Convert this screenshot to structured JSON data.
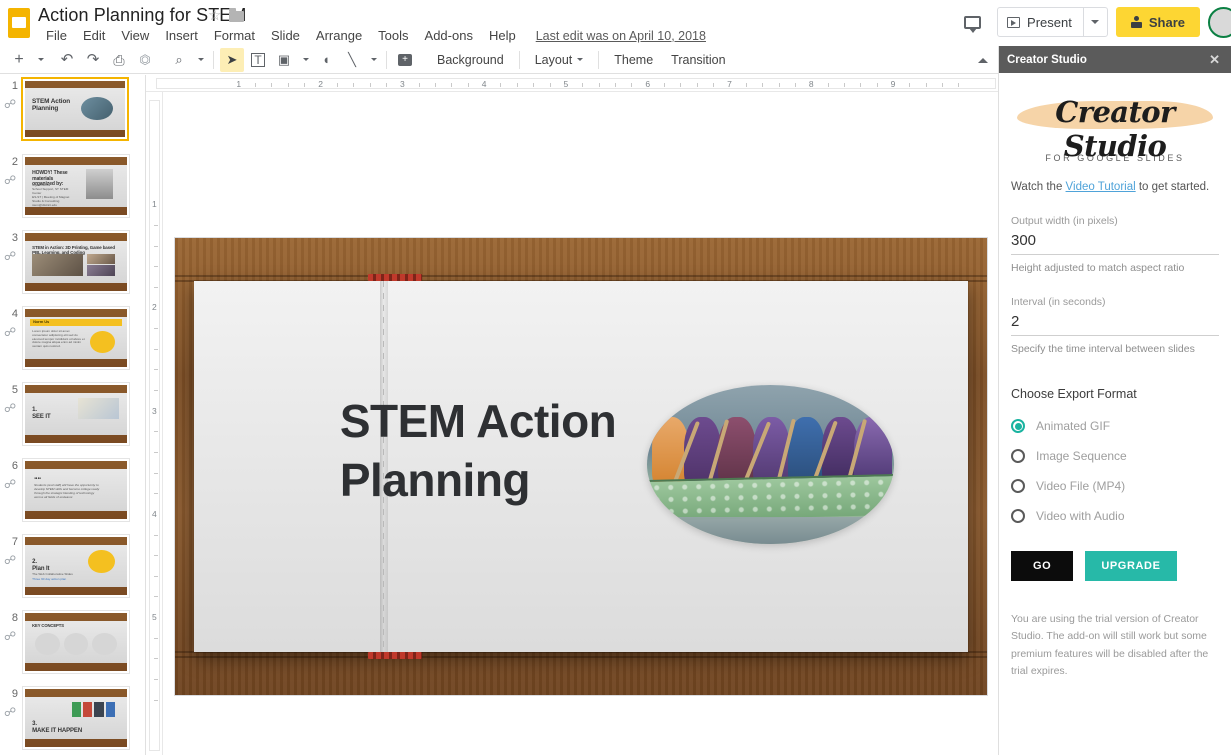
{
  "app": {
    "document_title": "Action Planning for STEM",
    "logo_icon": "google-slides-logo",
    "star_icon": "star-outline-icon",
    "folder_icon": "folder-icon",
    "last_edit": "Last edit was on April 10, 2018"
  },
  "menubar": {
    "items": [
      {
        "label": "File"
      },
      {
        "label": "Edit"
      },
      {
        "label": "View"
      },
      {
        "label": "Insert"
      },
      {
        "label": "Format"
      },
      {
        "label": "Slide"
      },
      {
        "label": "Arrange"
      },
      {
        "label": "Tools"
      },
      {
        "label": "Add-ons"
      },
      {
        "label": "Help"
      }
    ]
  },
  "topright": {
    "comment_icon": "comment-icon",
    "present_label": "Present",
    "present_icon": "present-play-icon",
    "present_caret_icon": "chevron-down-icon",
    "share_label": "Share",
    "share_icon": "person-lock-icon",
    "avatar": "user-avatar"
  },
  "toolbar": {
    "icons": [
      {
        "name": "new-slide-icon",
        "glyph": "+"
      },
      {
        "name": "undo-icon",
        "glyph": "↶"
      },
      {
        "name": "redo-icon",
        "glyph": "↷"
      },
      {
        "name": "print-icon",
        "glyph": "⎙"
      },
      {
        "name": "paint-format-icon",
        "glyph": "⚒"
      },
      {
        "name": "zoom-icon",
        "glyph": "⌕"
      },
      {
        "name": "select-tool-icon",
        "glyph": "➤"
      },
      {
        "name": "text-box-icon",
        "glyph": "T"
      },
      {
        "name": "insert-image-icon",
        "glyph": "▣"
      },
      {
        "name": "shape-icon",
        "glyph": "○"
      },
      {
        "name": "line-icon",
        "glyph": "╲"
      },
      {
        "name": "add-comment-icon",
        "glyph": "+"
      }
    ],
    "buttons": [
      {
        "label": "Background",
        "caret": false
      },
      {
        "label": "Layout",
        "caret": true
      },
      {
        "label": "Theme",
        "caret": false
      },
      {
        "label": "Transition",
        "caret": false
      }
    ],
    "collapse_icon": "chevron-up-icon"
  },
  "rulers": {
    "horizontal_ticks": [
      "1",
      "2",
      "3",
      "4",
      "5",
      "6",
      "7",
      "8",
      "9"
    ],
    "vertical_ticks": [
      "1",
      "2",
      "3",
      "4",
      "5"
    ]
  },
  "filmstrip": {
    "slides": [
      {
        "number": "1",
        "selected": true,
        "title": "STEM Action Planning",
        "kind": "title-photo"
      },
      {
        "number": "2",
        "selected": false,
        "title": "HOWDY! These materials organized by:",
        "kind": "bio"
      },
      {
        "number": "3",
        "selected": false,
        "title": "STEM in Action: 3D Printing, Game based PBL Learning, and Coding",
        "kind": "photo-grid"
      },
      {
        "number": "4",
        "selected": false,
        "title": "Norm Us",
        "kind": "yellow-banner"
      },
      {
        "number": "5",
        "selected": false,
        "title": "1. SEE IT",
        "kind": "numbered"
      },
      {
        "number": "6",
        "selected": false,
        "title": "Students (and staff) will have the opportunity to develop STEM skills and become college ready through the strategic blending of technology across all fields of endeavor.",
        "kind": "quote"
      },
      {
        "number": "7",
        "selected": false,
        "title": "2. Plan It",
        "kind": "numbered-icon"
      },
      {
        "number": "8",
        "selected": false,
        "title": "KEY CONCEPTS",
        "kind": "three-circles"
      },
      {
        "number": "9",
        "selected": false,
        "title": "3. MAKE IT HAPPEN",
        "kind": "people"
      }
    ]
  },
  "slide_canvas": {
    "headline": "STEM Action Planning",
    "image_name": "dragon-boat-racing-photo",
    "background_name": "wooden-shelf-open-book-background"
  },
  "addon": {
    "header_title": "Creator Studio",
    "close_icon": "close-icon",
    "brand_name": "Creator Studio",
    "brand_subtitle": "FOR GOOGLE SLIDES",
    "tutorial_prefix": "Watch the ",
    "tutorial_link": "Video Tutorial",
    "tutorial_suffix": " to get started.",
    "output_width_label": "Output width (in pixels)",
    "output_width_value": "300",
    "output_width_help": "Height adjusted to match aspect ratio",
    "interval_label": "Interval (in seconds)",
    "interval_value": "2",
    "interval_help": "Specify the time interval between slides",
    "format_title": "Choose Export Format",
    "formats": [
      {
        "label": "Animated GIF",
        "selected": true
      },
      {
        "label": "Image Sequence",
        "selected": false
      },
      {
        "label": "Video File (MP4)",
        "selected": false
      },
      {
        "label": "Video with Audio",
        "selected": false
      }
    ],
    "go_label": "GO",
    "upgrade_label": "UPGRADE",
    "trial_note": "You are using the trial version of Creator Studio. The add-on will still work but some premium features will be disabled after the trial expires.",
    "accent_color": "#27b9a8",
    "go_color": "#0c0c0c",
    "header_color": "#5b5b5b",
    "brand_swoosh_color": "#f6d4a8"
  }
}
